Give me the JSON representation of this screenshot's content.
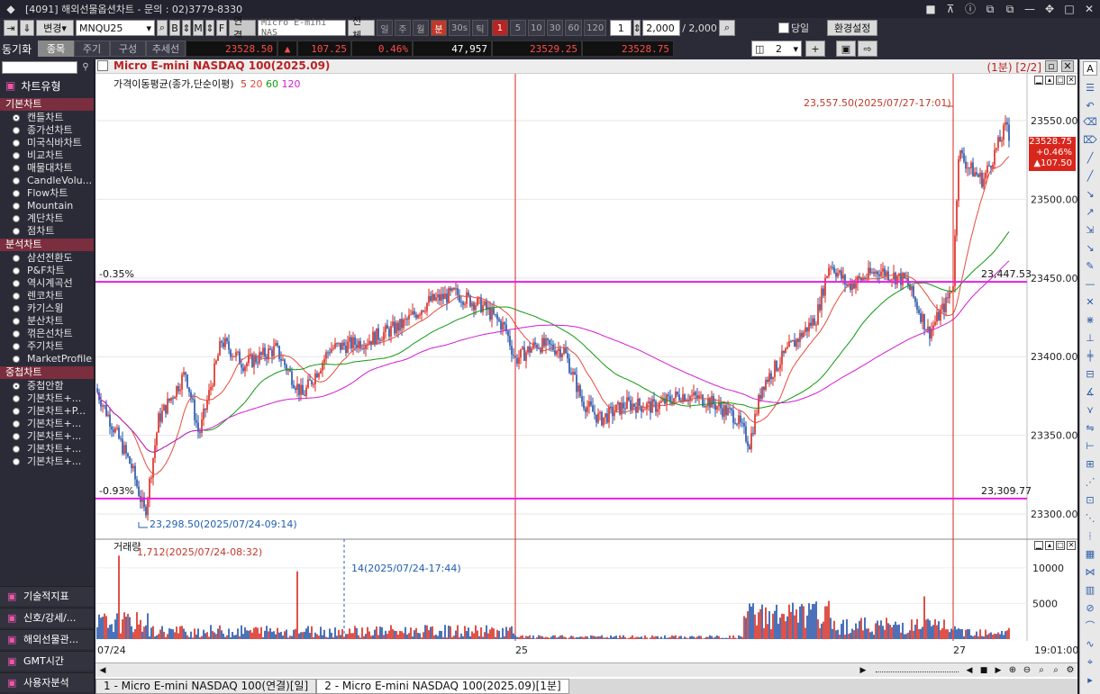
{
  "window": {
    "title": "[4091] 해외선물옵션차트 - 문의 : 02)3779-8330"
  },
  "toolbar": {
    "change_label": "변경",
    "symbol": "MNQU25",
    "b_label": "B",
    "m_label": "M",
    "f_label": "F",
    "link_label": "연결",
    "symbol_name": "Micro E-mini NAS",
    "all_label": "전체",
    "periods": [
      "일",
      "주",
      "월",
      "분",
      "30s",
      "틱"
    ],
    "active_period": "분",
    "intervals": [
      "1",
      "5",
      "10",
      "30",
      "60",
      "120"
    ],
    "active_interval": "1",
    "interval_value": "1",
    "count_value": "2,000",
    "count_total": "/ 2,000",
    "same_day_label": "당일",
    "settings_label": "환경설정"
  },
  "toolbar2": {
    "sync_label": "동기화",
    "tabs": [
      "종목",
      "주기",
      "구성",
      "추세선"
    ],
    "price": "23528.50",
    "change": "107.25",
    "change_pct": "0.46%",
    "volume": "47,957",
    "bid": "23529.25",
    "ask": "23528.75",
    "layout_count": "2"
  },
  "sidebar": {
    "header": "차트유형",
    "cat_basic": "기본차트",
    "basic_items": [
      "캔들차트",
      "종가선차트",
      "미국식바차트",
      "비교차트",
      "매물대차트",
      "CandleVolu...",
      "Flow차트",
      "Mountain",
      "계단차트",
      "점차트"
    ],
    "cat_analysis": "분석차트",
    "analysis_items": [
      "삼선전환도",
      "P&F차트",
      "역시계곡선",
      "렌코차트",
      "카기스윙",
      "분산차트",
      "꺾은선차트",
      "주기차트",
      "MarketProfile"
    ],
    "cat_overlay": "중첩차트",
    "overlay_items": [
      "중첩안함",
      "기본차트+...",
      "기본차트+P...",
      "기본차트+...",
      "기본차트+...",
      "기본차트+...",
      "기본차트+..."
    ],
    "bottom_items": [
      "기술적지표",
      "신호/강세/...",
      "해외선물관...",
      "GMT시간",
      "사용자분석"
    ]
  },
  "chart": {
    "title": "Micro E-mini NASDAQ 100(2025.09)",
    "page_info": "(1분) [2/2]",
    "ma_label": "가격이동평균(종가,단순이평)",
    "ma_periods": [
      "5",
      "20",
      "60",
      "120"
    ],
    "ma_colors": [
      "#c0392b",
      "#e74c3c",
      "#119911",
      "#d21bd2"
    ],
    "high_note": "23,557.50(2025/07/27-17:01)",
    "low_note": "23,298.50(2025/07/24-09:14)",
    "line_upper_pct": "-0.35%",
    "line_upper_val": "23,447.53",
    "line_lower_pct": "-0.93%",
    "line_lower_val": "23,309.77",
    "price_box": [
      "23528.75",
      "+0.46%",
      "▲107.50"
    ],
    "y_ticks": [
      "23550.00",
      "23500.00",
      "23450.00",
      "23400.00",
      "23350.00",
      "23300.00"
    ],
    "x_ticks": [
      "07/24",
      "25",
      "27"
    ],
    "time_label": "19:01:00",
    "volume_title": "거래량",
    "volume_high_note": "1,712(2025/07/24-08:32)",
    "volume_low_note": "14(2025/07/24-17:44)",
    "volume_ticks": [
      "10000",
      "5000"
    ]
  },
  "tabs": [
    "1 - Micro E-mini NASDAQ 100(연결)[일]",
    "2 - Micro E-mini NASDAQ 100(2025.09)[1분]"
  ]
}
